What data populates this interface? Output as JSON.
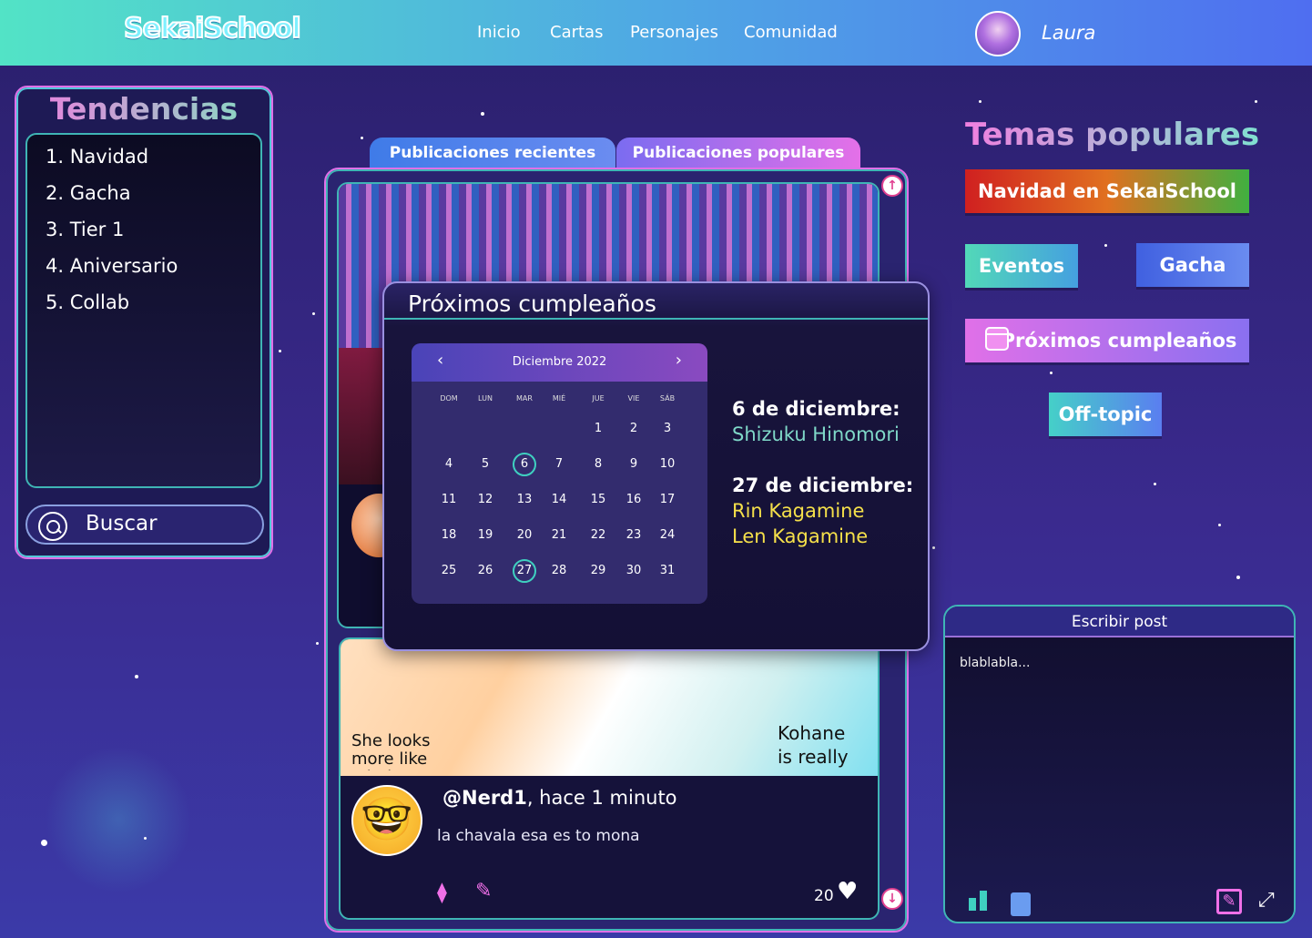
{
  "header": {
    "logo": "SekaiSchool",
    "nav": [
      "Inicio",
      "Cartas",
      "Personajes",
      "Comunidad"
    ],
    "user_name": "Laura"
  },
  "trends": {
    "title": "Tendencias",
    "items": [
      "1. Navidad",
      "2. Gacha",
      "3. Tier 1",
      "4. Aniversario",
      "5. Collab"
    ],
    "search_label": "Buscar"
  },
  "feed": {
    "tabs": [
      "Publicaciones recientes",
      "Publicaciones populares"
    ],
    "post2": {
      "manga_text_1": "She looks more like a baby",
      "manga_text_2": "Kohane is really",
      "user": "@Nerd1",
      "time": ", hace 1 minuto",
      "text": "la chavala esa es to mona",
      "likes": "20",
      "avatar_emoji": "🤓"
    }
  },
  "birthdays": {
    "title": "Próximos cumpleaños",
    "calendar": {
      "month": "Diciembre 2022",
      "weekdays": [
        "DOM",
        "LUN",
        "MAR",
        "MIÉ",
        "JUE",
        "VIE",
        "SÁB"
      ],
      "first_weekday": 4,
      "days_in_month": 31,
      "marked_days": [
        6,
        27
      ]
    },
    "entries": [
      {
        "date": "6 de diciembre:",
        "names": [
          "Shizuku Hinomori"
        ],
        "color": "#7fd8c8"
      },
      {
        "date": "27 de diciembre:",
        "names": [
          "Rin Kagamine",
          "Len Kagamine"
        ],
        "color": "#f5e04a"
      }
    ]
  },
  "popular": {
    "title": "Temas populares",
    "tags": {
      "navidad": "Navidad en SekaiSchool",
      "eventos": "Eventos",
      "gacha": "Gacha",
      "cumple": "Próximos cumpleaños",
      "offtopic": "Off-topic"
    }
  },
  "write_post": {
    "title": "Escribir post",
    "draft": "blablabla..."
  },
  "colors": {
    "accent_pink": "#e070e8",
    "accent_teal": "#3fb5b5"
  }
}
